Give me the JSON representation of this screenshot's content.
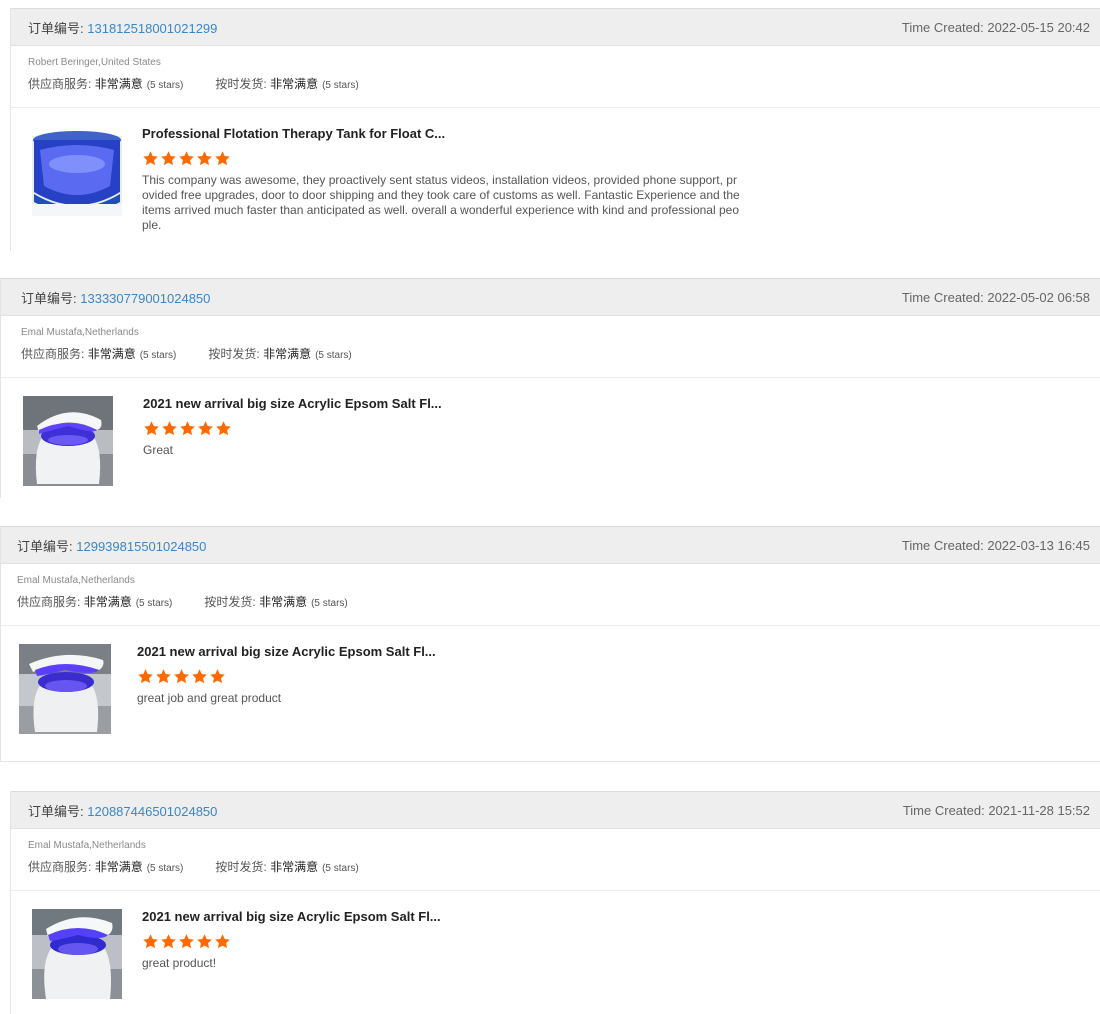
{
  "colors": {
    "order_link": "#3a86c8",
    "star": "#ff6a00",
    "header_bg": "#eeeeee"
  },
  "icons": {
    "star": "star-icon",
    "thumbnail_float_tank": "float-tank-thumbnail",
    "thumbnail_float_pod": "float-pod-thumbnail"
  },
  "reviews": [
    {
      "order_label": "订单编号:",
      "order_number": "131812518001021299",
      "time_created": "Time Created: 2022-05-15 20:42",
      "buyer": "Robert Beringer,United States",
      "service_label": "供应商服务:",
      "service_value": "非常满意",
      "service_stars": "(5 stars)",
      "shipping_label": "按时发货:",
      "shipping_value": "非常满意",
      "shipping_stars": "(5 stars)",
      "product_title": "Professional Flotation Therapy Tank for Float C...",
      "rating": 5,
      "review_text": "This company was awesome, they proactively sent status videos, installation videos, provided phone support, provided free upgrades, door to door shipping and they took care of customs as well.  Fantastic Experience and the items arrived much faster than anticipated as well. overall a wonderful experience with kind and professional people."
    },
    {
      "order_label": "订单编号:",
      "order_number": "133330779001024850",
      "time_created": "Time Created: 2022-05-02 06:58",
      "buyer": "Emal Mustafa,Netherlands",
      "service_label": "供应商服务:",
      "service_value": "非常满意",
      "service_stars": "(5 stars)",
      "shipping_label": "按时发货:",
      "shipping_value": "非常满意",
      "shipping_stars": "(5 stars)",
      "product_title": "2021 new arrival big size Acrylic Epsom Salt Fl...",
      "rating": 5,
      "review_text": "Great"
    },
    {
      "order_label": "订单编号:",
      "order_number": "129939815501024850",
      "time_created": "Time Created: 2022-03-13 16:45",
      "buyer": "Emal Mustafa,Netherlands",
      "service_label": "供应商服务:",
      "service_value": "非常满意",
      "service_stars": "(5 stars)",
      "shipping_label": "按时发货:",
      "shipping_value": "非常满意",
      "shipping_stars": "(5 stars)",
      "product_title": "2021 new arrival big size Acrylic Epsom Salt Fl...",
      "rating": 5,
      "review_text": "great job and great product"
    },
    {
      "order_label": "订单编号:",
      "order_number": "120887446501024850",
      "time_created": "Time Created: 2021-11-28 15:52",
      "buyer": "Emal Mustafa,Netherlands",
      "service_label": "供应商服务:",
      "service_value": "非常满意",
      "service_stars": "(5 stars)",
      "shipping_label": "按时发货:",
      "shipping_value": "非常满意",
      "shipping_stars": "(5 stars)",
      "product_title": "2021 new arrival big size Acrylic Epsom Salt Fl...",
      "rating": 5,
      "review_text": "great product!"
    }
  ]
}
